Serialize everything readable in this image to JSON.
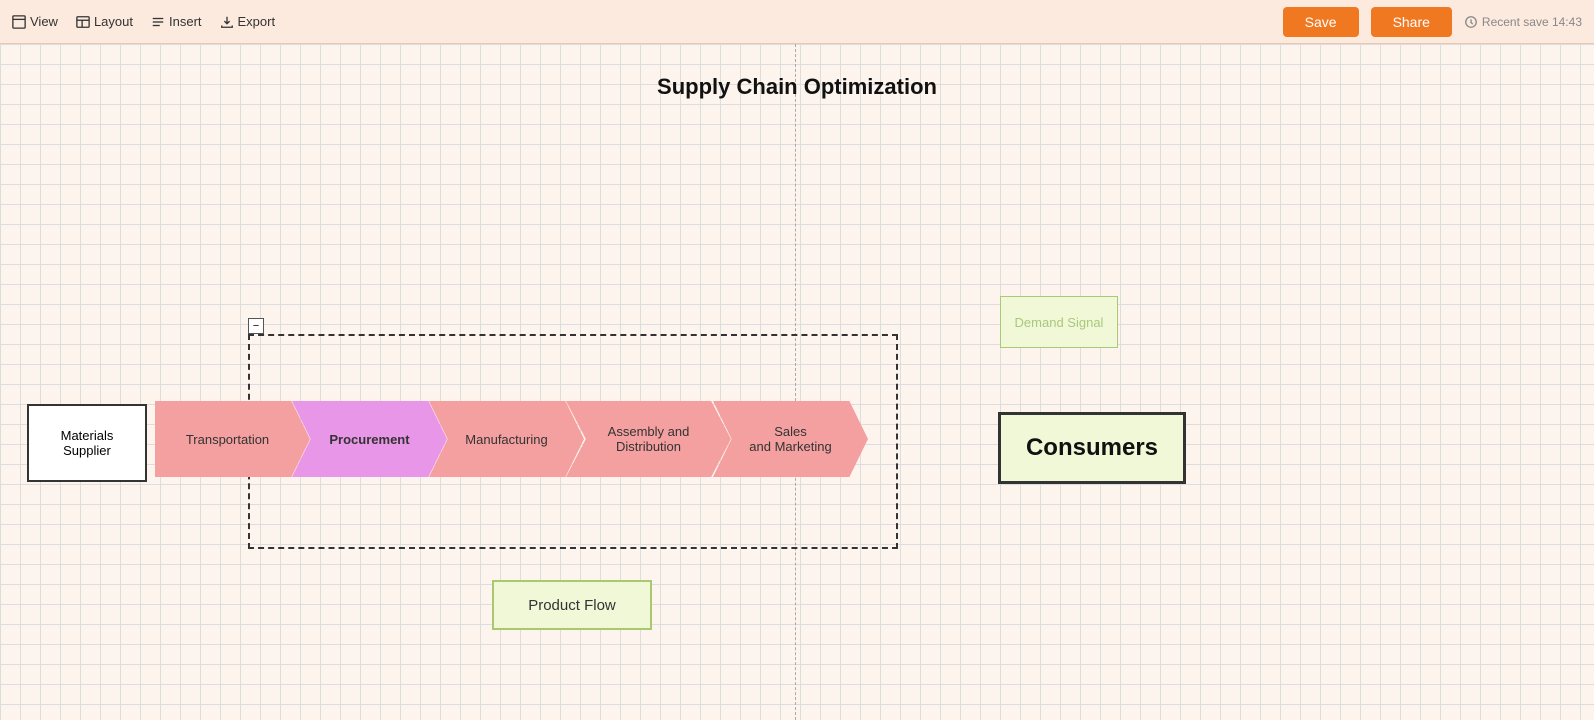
{
  "toolbar": {
    "menu_items": [
      {
        "label": "View",
        "icon": "view-icon"
      },
      {
        "label": "Layout",
        "icon": "layout-icon"
      },
      {
        "label": "Insert",
        "icon": "insert-icon"
      },
      {
        "label": "Export",
        "icon": "export-icon"
      }
    ],
    "save_label": "Save",
    "share_label": "Share",
    "recent_save_label": "Recent save 14:43"
  },
  "diagram": {
    "title": "Supply Chain Optimization",
    "materials_supplier_label": "Materials\nSupplier",
    "arrows": [
      {
        "id": "transportation",
        "label": "Transportation"
      },
      {
        "id": "procurement",
        "label": "Procurement"
      },
      {
        "id": "manufacturing",
        "label": "Manufacturing"
      },
      {
        "id": "assembly",
        "label": "Assembly and\nDistribution"
      },
      {
        "id": "sales",
        "label": "Sales\nand Marketing"
      }
    ],
    "consumers_label": "Consumers",
    "demand_signal_label": "Demand\nSignal",
    "product_flow_label": "Product Flow"
  }
}
